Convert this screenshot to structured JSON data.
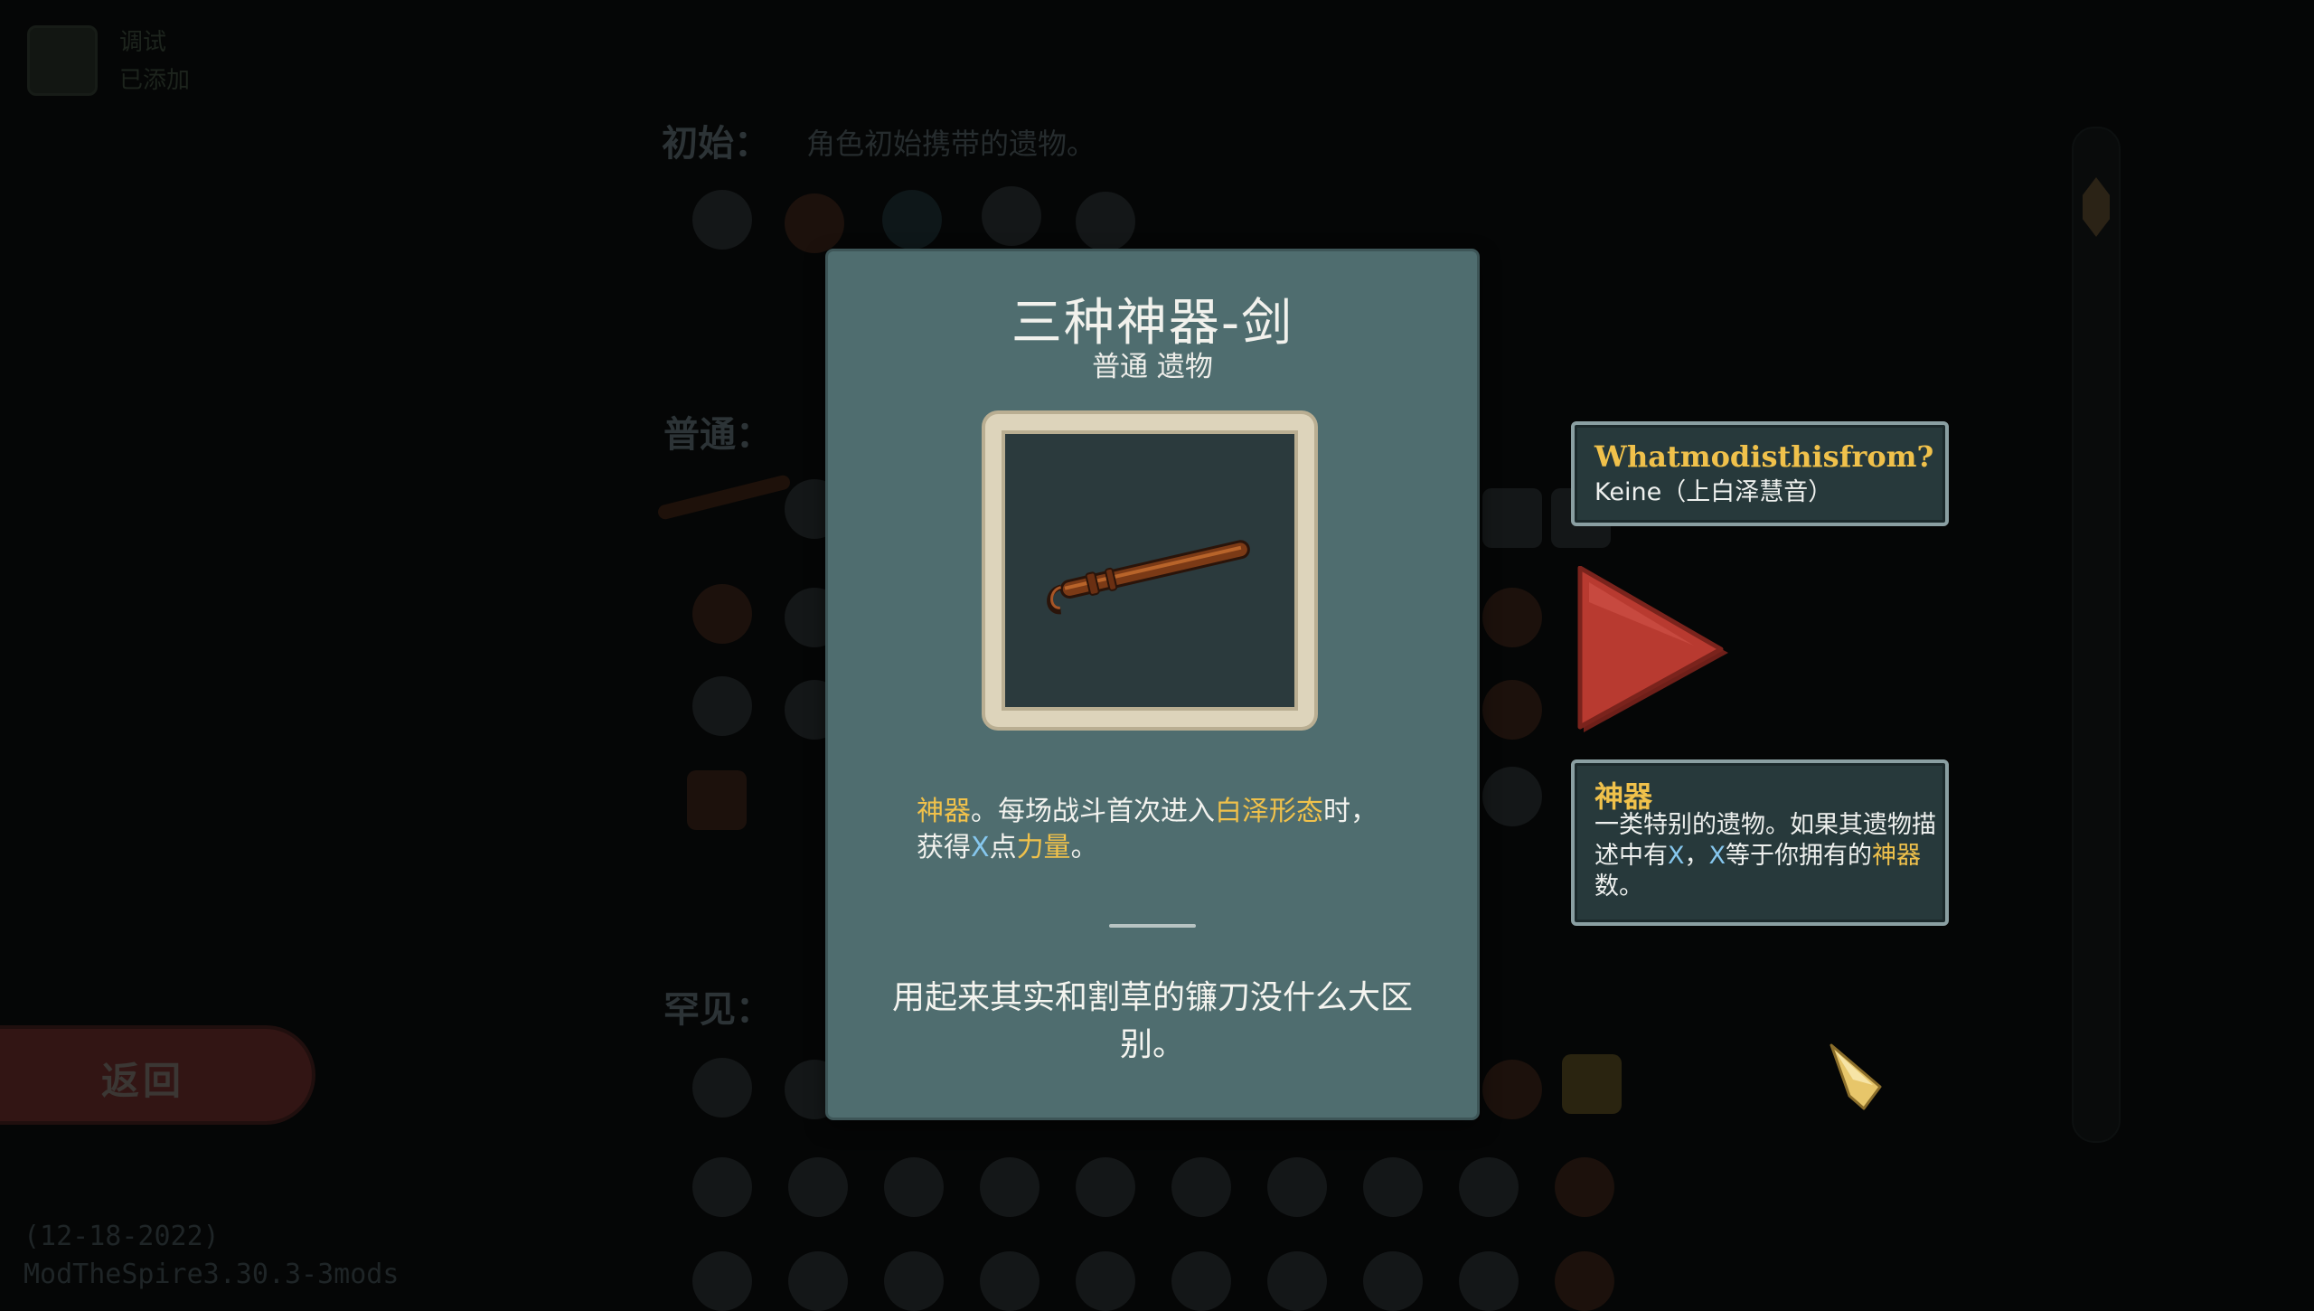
{
  "background": {
    "top_text_line1": "调试",
    "top_text_line2": "已添加",
    "sections": [
      {
        "label": "初始：",
        "desc": "角色初始携带的遗物。"
      },
      {
        "label": "普通：",
        "desc": ""
      },
      {
        "label": "罕见：",
        "desc": ""
      }
    ],
    "back_label": "返回",
    "version_line1": "(12-18-2022)",
    "version_line2": "ModTheSpire3.30.3-3mods"
  },
  "card": {
    "title": "三种神器-剑",
    "subtitle": "普通 遗物",
    "image_icon": "sword-icon",
    "description": {
      "kw1": "神器",
      "t1": "。每场战斗首次进入",
      "kw2": "白泽形态",
      "t2": "时，",
      "t3": "获得",
      "x": "X",
      "t4": "点",
      "kw3": "力量",
      "t5": "。"
    },
    "flavor": "用起来其实和割草的镰刀没什么大区别。"
  },
  "mod_tooltip": {
    "title": "Whatmodisthisfrom?",
    "body": "Keine（上白泽慧音）"
  },
  "keyword_tooltip": {
    "title": "神器",
    "b1": "一类特别的遗物。如果其遗物描述中有",
    "x1": "X",
    "b2": "，",
    "x2": "X",
    "b3": "等于你拥有的",
    "kw": "神器",
    "b4": "数。"
  },
  "colors": {
    "card_bg": "#4f6d6f",
    "keyword": "#f0c14b",
    "x_value": "#86c7ee",
    "arrow": "#b83a30"
  }
}
